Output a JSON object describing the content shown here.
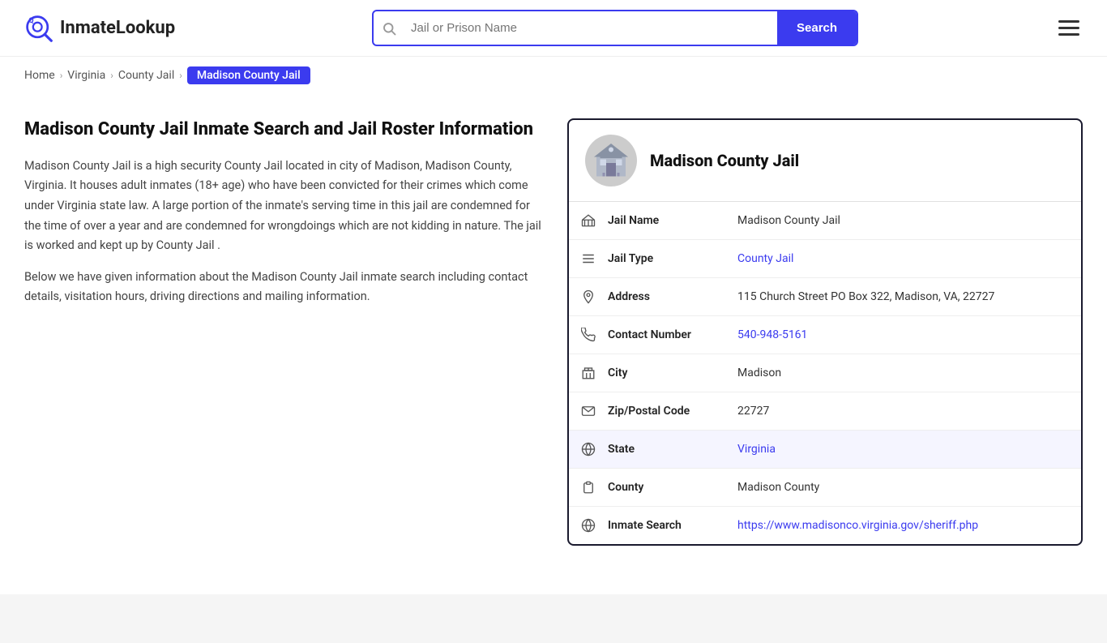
{
  "header": {
    "logo_text_highlight": "Inmate",
    "logo_text_normal": "Lookup",
    "search_placeholder": "Jail or Prison Name",
    "search_button_label": "Search",
    "menu_label": "Menu"
  },
  "breadcrumb": {
    "home": "Home",
    "virginia": "Virginia",
    "county_jail": "County Jail",
    "current": "Madison County Jail"
  },
  "left": {
    "heading": "Madison County Jail Inmate Search and Jail Roster Information",
    "para1": "Madison County Jail is a high security County Jail located in city of Madison, Madison County, Virginia. It houses adult inmates (18+ age) who have been convicted for their crimes which come under Virginia state law. A large portion of the inmate's serving time in this jail are condemned for the time of over a year and are condemned for wrongdoings which are not kidding in nature. The jail is worked and kept up by County Jail .",
    "para2": "Below we have given information about the Madison County Jail inmate search including contact details, visitation hours, driving directions and mailing information."
  },
  "card": {
    "title": "Madison County Jail",
    "rows": [
      {
        "icon": "🏛",
        "label": "Jail Name",
        "value": "Madison County Jail",
        "link": null,
        "shaded": false
      },
      {
        "icon": "☰",
        "label": "Jail Type",
        "value": "County Jail",
        "link": "#",
        "shaded": false
      },
      {
        "icon": "📍",
        "label": "Address",
        "value": "115 Church Street PO Box 322, Madison, VA, 22727",
        "link": null,
        "shaded": false
      },
      {
        "icon": "📞",
        "label": "Contact Number",
        "value": "540-948-5161",
        "link": "tel:540-948-5161",
        "shaded": false
      },
      {
        "icon": "🏙",
        "label": "City",
        "value": "Madison",
        "link": null,
        "shaded": false
      },
      {
        "icon": "✉",
        "label": "Zip/Postal Code",
        "value": "22727",
        "link": null,
        "shaded": false
      },
      {
        "icon": "🌐",
        "label": "State",
        "value": "Virginia",
        "link": "#",
        "shaded": true
      },
      {
        "icon": "📋",
        "label": "County",
        "value": "Madison County",
        "link": null,
        "shaded": false
      },
      {
        "icon": "🌐",
        "label": "Inmate Search",
        "value": "https://www.madisonco.virginia.gov/sheriff.php",
        "link": "https://www.madisonco.virginia.gov/sheriff.php",
        "shaded": false
      }
    ]
  }
}
